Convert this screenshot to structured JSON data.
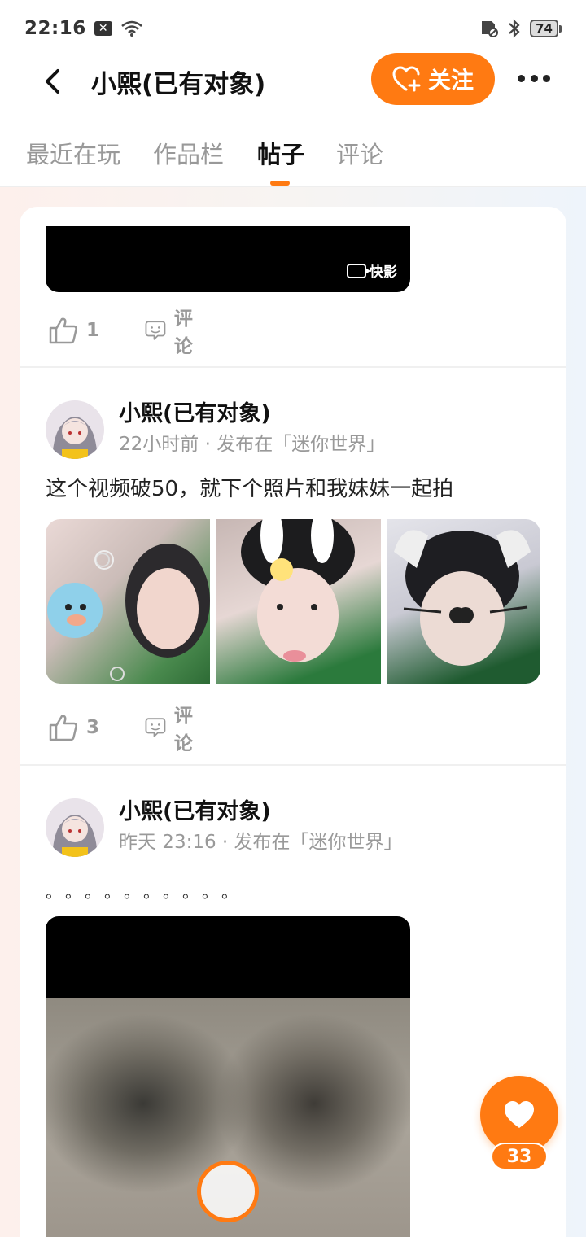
{
  "status_bar": {
    "time": "22:16",
    "battery": "74",
    "icons": [
      "notification-x-icon",
      "wifi-icon",
      "sim-off-icon",
      "bluetooth-icon",
      "battery-icon"
    ]
  },
  "header": {
    "title": "小熙(已有对象)",
    "follow_label": "关注",
    "accent_color": "#ff7a12"
  },
  "tabs": [
    {
      "label": "最近在玩",
      "active": false
    },
    {
      "label": "作品栏",
      "active": false
    },
    {
      "label": "帖子",
      "active": true
    },
    {
      "label": "评论",
      "active": false
    }
  ],
  "posts": [
    {
      "video_watermark": "快影",
      "likes": "1",
      "comment_label": "评论"
    },
    {
      "author": "小熙(已有对象)",
      "meta": "22小时前 · 发布在「迷你世界」",
      "text": "这个视频破50，就下个照片和我妹妹一起拍",
      "images": [
        "photo-1",
        "photo-2",
        "photo-3"
      ],
      "likes": "3",
      "comment_label": "评论"
    },
    {
      "author": "小熙(已有对象)",
      "meta": "昨天 23:16 · 发布在「迷你世界」",
      "text": "。。。。。。。。。。"
    }
  ],
  "floating": {
    "favorite_count": "33"
  }
}
